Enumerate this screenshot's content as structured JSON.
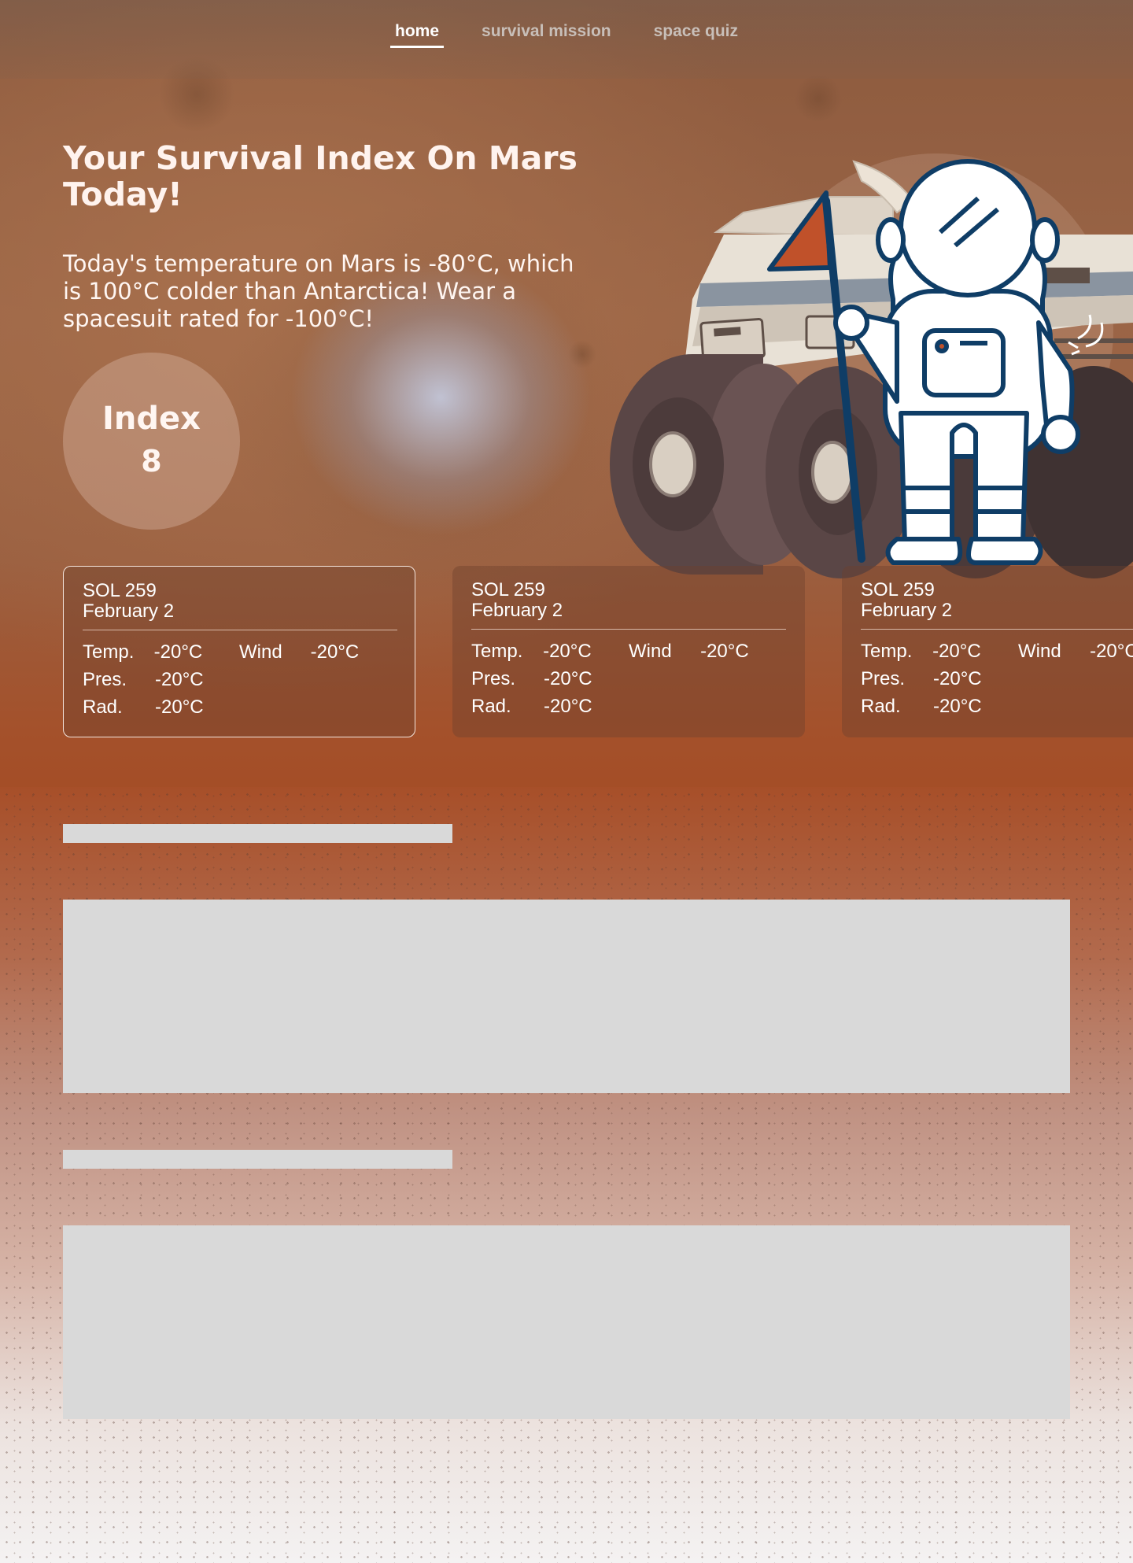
{
  "nav": {
    "items": [
      {
        "label": "home",
        "active": true
      },
      {
        "label": "survival mission",
        "active": false
      },
      {
        "label": "space quiz",
        "active": false
      }
    ]
  },
  "hero": {
    "title": "Your Survival Index On Mars Today!",
    "description": "Today's temperature on Mars is -80°C, which is 100°C colder than Antarctica! Wear a spacesuit rated for -100°C!",
    "index_label": "Index",
    "index_value": "8"
  },
  "sol_cards": [
    {
      "sol": "SOL 259",
      "date": "February 2",
      "temp_label": "Temp.",
      "temp": "-20°C",
      "wind_label": "Wind",
      "wind": "-20°C",
      "pres_label": "Pres.",
      "pres": "-20°C",
      "rad_label": "Rad.",
      "rad": "-20°C",
      "selected": true
    },
    {
      "sol": "SOL 259",
      "date": "February 2",
      "temp_label": "Temp.",
      "temp": "-20°C",
      "wind_label": "Wind",
      "wind": "-20°C",
      "pres_label": "Pres.",
      "pres": "-20°C",
      "rad_label": "Rad.",
      "rad": "-20°C",
      "selected": false
    },
    {
      "sol": "SOL 259",
      "date": "February 2",
      "temp_label": "Temp.",
      "temp": "-20°C",
      "wind_label": "Wind",
      "wind": "-20°C",
      "pres_label": "Pres.",
      "pres": "-20°C",
      "rad_label": "Rad.",
      "rad": "-20°C",
      "selected": false
    }
  ],
  "icons": {
    "illustration": "astronaut-with-flag-and-rover-icon",
    "flag_color": "#c0512a",
    "suit_outline_color": "#0f3d66"
  },
  "colors": {
    "nav_active": "#ffffff",
    "nav_inactive": "#c8bfb9",
    "placeholder": "#d9d9d9"
  }
}
